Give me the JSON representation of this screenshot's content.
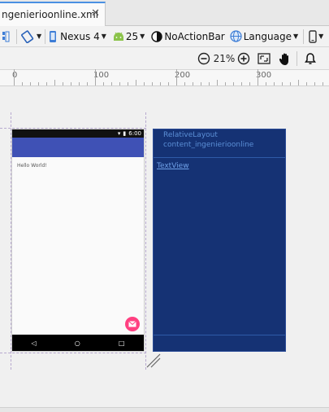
{
  "tab": {
    "title": "ngenierioonline.xml",
    "close": "✕"
  },
  "toolbar": {
    "device": "Nexus 4",
    "api": "25",
    "theme": "NoActionBar",
    "language": "Language"
  },
  "zoom": {
    "level": "21%"
  },
  "ruler": {
    "ticks": [
      "0",
      "100",
      "200",
      "300"
    ]
  },
  "phone": {
    "status_time": "6:00",
    "hello_text": "Hello World!",
    "nav": [
      "◁",
      "○",
      "□"
    ]
  },
  "blueprint": {
    "layout_label": "RelativeLayout",
    "layout_id": "content_ingenierioonline",
    "textview_label": "TextView"
  },
  "colors": {
    "app_bar": "#3f51b5",
    "fab": "#ff4081",
    "blueprint_bg": "#153274"
  },
  "icons": [
    "design-surface-icon",
    "orientation-icon",
    "phone-icon",
    "android-icon",
    "theme-icon",
    "globe-icon",
    "device-preview-icon",
    "zoom-out-icon",
    "zoom-in-icon",
    "fit-screen-icon",
    "pan-hand-icon",
    "notification-icon"
  ]
}
